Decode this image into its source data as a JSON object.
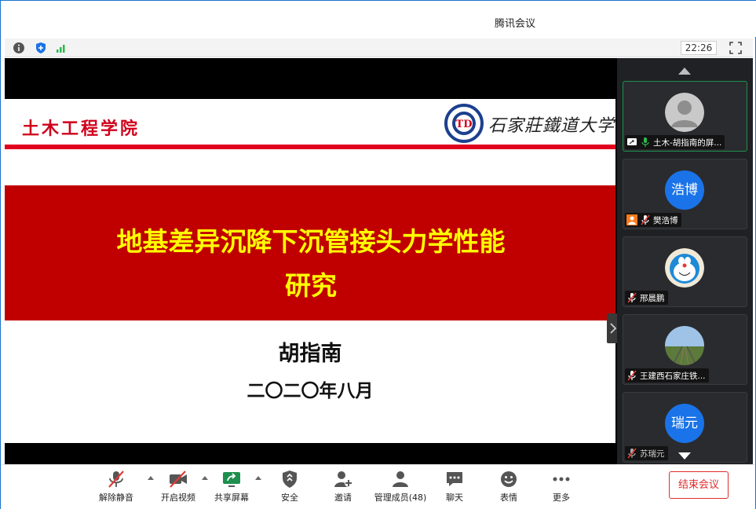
{
  "window": {
    "title": "腾讯会议"
  },
  "topbar": {
    "clock": "22:26",
    "icons": [
      "info-icon",
      "shield-icon",
      "signal-icon",
      "fullscreen-icon"
    ]
  },
  "slide": {
    "college": "土木工程学院",
    "university": "石家莊鐵道大学",
    "logo_letters": "TD",
    "title_line1": "地基差异沉降下沉管接头力学性能",
    "title_line2": "研究",
    "author": "胡指南",
    "date": "二〇二〇年八月",
    "colors": {
      "band": "#c00000",
      "title": "#ffff00",
      "college": "#d0021b"
    }
  },
  "participants": [
    {
      "name": "土木-胡指南的屏...",
      "avatar": "gray-silhouette",
      "status": [
        "screen-share-icon",
        "mic-on-icon"
      ],
      "active": true
    },
    {
      "name": "樊浩博",
      "avatar_text": "浩博",
      "status": [
        "user-icon",
        "mic-muted-icon"
      ]
    },
    {
      "name": "邢晨鹏",
      "avatar": "doraemon-picture",
      "status": [
        "mic-muted-icon"
      ]
    },
    {
      "name": "王建西石家庄铁...",
      "avatar": "railway-picture",
      "status": [
        "mic-muted-icon"
      ]
    },
    {
      "name": "苏瑞元",
      "avatar_text": "瑞元",
      "status": [
        "mic-muted-icon"
      ]
    }
  ],
  "toolbar": {
    "unmute": "解除静音",
    "video": "开启视频",
    "share": "共享屏幕",
    "security": "安全",
    "invite": "邀请",
    "members": "管理成员(48)",
    "chat": "聊天",
    "reactions": "表情",
    "more": "更多",
    "end": "结束会议"
  }
}
